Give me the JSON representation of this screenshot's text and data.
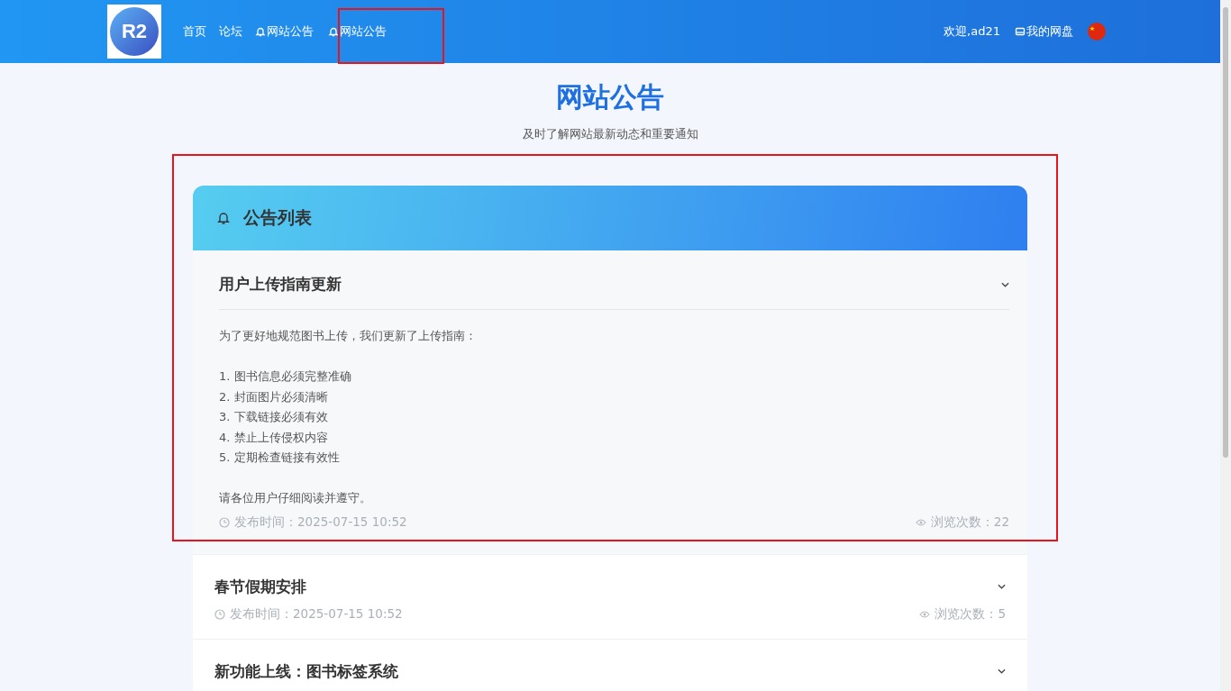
{
  "header": {
    "logo": "R2",
    "nav": [
      {
        "label": "首页",
        "icon": false
      },
      {
        "label": "论坛",
        "icon": false
      },
      {
        "label": "网站公告",
        "icon": true
      },
      {
        "label": "网站公告",
        "icon": true
      }
    ],
    "welcome": "欢迎,ad21",
    "drive": "我的网盘"
  },
  "page": {
    "title": "网站公告",
    "subtitle": "及时了解网站最新动态和重要通知"
  },
  "panel": {
    "title": "公告列表"
  },
  "announcements": [
    {
      "title": "用户上传指南更新",
      "expanded": true,
      "intro": "为了更好地规范图书上传，我们更新了上传指南：",
      "points": [
        "1. 图书信息必须完整准确",
        "2. 封面图片必须清晰",
        "3. 下载链接必须有效",
        "4. 禁止上传侵权内容",
        "5. 定期检查链接有效性"
      ],
      "closing": "请各位用户仔细阅读并遵守。",
      "published": "发布时间：2025-07-15 10:52",
      "views": "浏览次数：22"
    },
    {
      "title": "春节假期安排",
      "expanded": false,
      "published": "发布时间：2025-07-15 10:52",
      "views": "浏览次数：5"
    },
    {
      "title": "新功能上线：图书标签系统",
      "expanded": false
    }
  ]
}
